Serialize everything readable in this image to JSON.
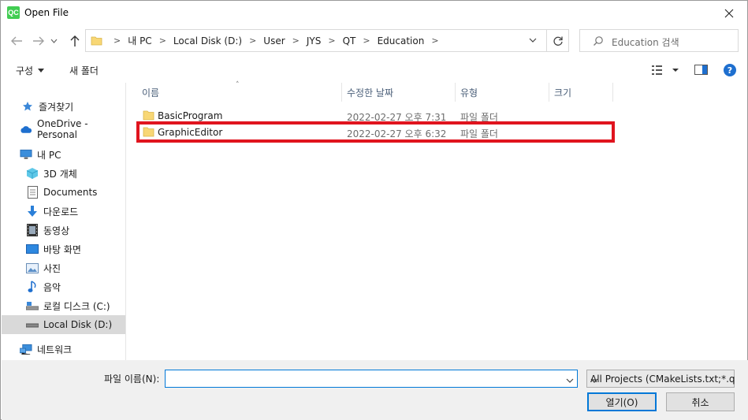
{
  "window": {
    "title": "Open File",
    "app_icon_text": "QC",
    "close_icon": "close-icon"
  },
  "nav": {
    "back_icon": "arrow-left-icon",
    "forward_icon": "arrow-right-icon",
    "recent_icon": "chevron-down-icon",
    "up_icon": "arrow-up-icon",
    "breadcrumbs": [
      "내 PC",
      "Local Disk (D:)",
      "User",
      "JYS",
      "QT",
      "Education"
    ],
    "refresh_icon": "refresh-icon",
    "search_placeholder": "Education 검색"
  },
  "toolbar": {
    "organize_label": "구성",
    "new_folder_label": "새 폴더"
  },
  "sidebar": {
    "items": [
      {
        "label": "즐겨찾기",
        "icon": "star-icon"
      },
      {
        "label": "OneDrive - Personal",
        "icon": "cloud-icon"
      },
      {
        "label": "내 PC",
        "icon": "computer-icon"
      },
      {
        "label": "3D 개체",
        "icon": "cube-icon"
      },
      {
        "label": "Documents",
        "icon": "document-icon"
      },
      {
        "label": "다운로드",
        "icon": "download-icon"
      },
      {
        "label": "동영상",
        "icon": "film-icon"
      },
      {
        "label": "바탕 화면",
        "icon": "desktop-icon"
      },
      {
        "label": "사진",
        "icon": "picture-icon"
      },
      {
        "label": "음악",
        "icon": "music-icon"
      },
      {
        "label": "로컬 디스크 (C:)",
        "icon": "drive-icon"
      },
      {
        "label": "Local Disk (D:)",
        "icon": "drive-icon"
      },
      {
        "label": "네트워크",
        "icon": "network-icon"
      }
    ]
  },
  "columns": {
    "name": "이름",
    "modified": "수정한 날짜",
    "type": "유형",
    "size": "크기"
  },
  "files": [
    {
      "name": "BasicProgram",
      "modified": "2022-02-27 오후 7:31",
      "type": "파일 폴더"
    },
    {
      "name": "GraphicEditor",
      "modified": "2022-02-27 오후 6:32",
      "type": "파일 폴더"
    }
  ],
  "footer": {
    "filename_label": "파일 이름(N):",
    "filename_value": "",
    "filter_value": "All Projects (CMakeLists.txt;*.q",
    "open_label": "열기(O)",
    "cancel_label": "취소"
  },
  "colors": {
    "highlight": "#e0141e",
    "folder": "#f8d775",
    "accent": "#0078d7",
    "selected": "#d9d9d9"
  }
}
